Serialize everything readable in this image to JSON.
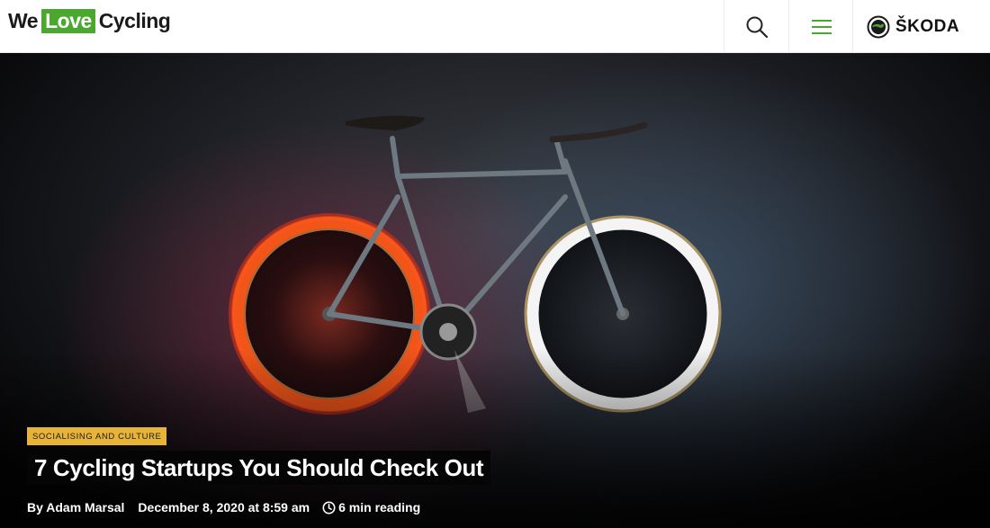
{
  "site": {
    "logo_we": "We",
    "logo_love": "Love",
    "logo_cycling": "Cycling"
  },
  "header": {
    "search_icon": "search-icon",
    "menu_icon": "hamburger-menu-icon",
    "brand_logo": "ŠKODA",
    "accent_color": "#4ba82e"
  },
  "article": {
    "category": "SOCIALISING AND CULTURE",
    "category_color": "#e7b437",
    "title": "7 Cycling Startups You Should Check Out",
    "author": "By Adam Marsal",
    "date": "December 8, 2020 at 8:59 am",
    "reading_time": "6 min reading",
    "reading_icon": "clock-icon",
    "hero_image": "fixed-gear-bike-with-glowing-wheels"
  }
}
